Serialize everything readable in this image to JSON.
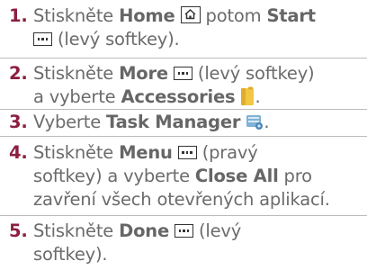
{
  "steps": [
    {
      "num": "1.",
      "t1": "Stiskněte ",
      "b1": "Home",
      "t2": " potom ",
      "b2": "Start",
      "t3": " (levý softkey)."
    },
    {
      "num": "2.",
      "t1": "Stiskněte ",
      "b1": "More",
      "t2": " (levý softkey)",
      "t3": "a vyberte ",
      "b2": "Accessories",
      "t4": "."
    },
    {
      "num": "3.",
      "t1": "Vyberte ",
      "b1": "Task Manager",
      "t2": "."
    },
    {
      "num": "4.",
      "t1": "Stiskněte ",
      "b1": "Menu",
      "t2": " (pravý",
      "t3": "softkey) a vyberte ",
      "b2": "Close All",
      "t4": " pro",
      "t5": "zavření všech otevřených aplikací."
    },
    {
      "num": "5.",
      "t1": "Stiskněte ",
      "b1": "Done",
      "t2": " (levý",
      "t3": "softkey)."
    }
  ],
  "icons": {
    "home": "home-key-icon",
    "softkey": "softkey-icon",
    "accessories": "folder-icon",
    "task_manager": "task-manager-icon"
  },
  "colors": {
    "number": "#8c1f3f",
    "text": "#6b6b6b",
    "divider": "#bcbcbc",
    "folder": "#f2c744"
  }
}
